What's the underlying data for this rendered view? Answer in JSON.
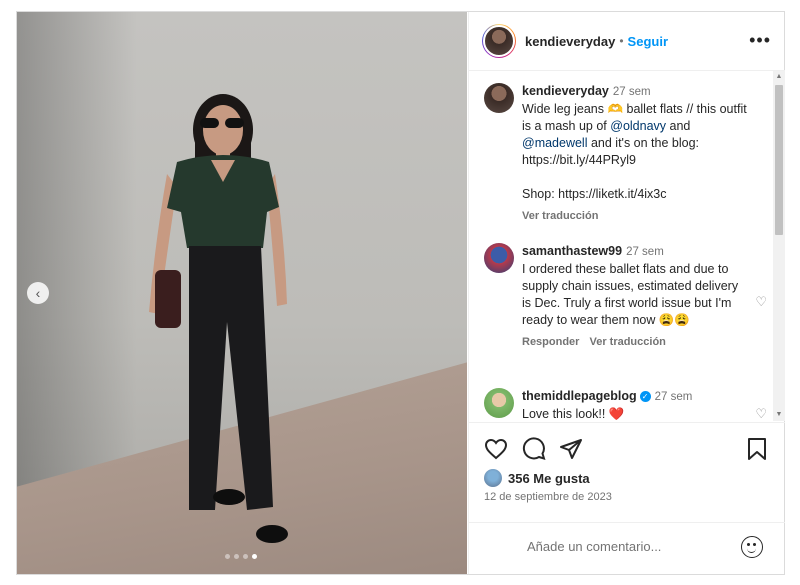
{
  "header": {
    "username": "kendieveryday",
    "separator": "•",
    "follow": "Seguir",
    "more": "•••"
  },
  "caption": {
    "username": "kendieveryday",
    "time": "27 sem",
    "text_1": "Wide leg jeans 🫶 ballet flats // this outfit is a mash up of ",
    "mention_1": "@oldnavy",
    "text_2": " and ",
    "mention_2": "@madewell",
    "text_3": " and it's on the blog: https://bit.ly/44PRyl9",
    "shop": "Shop: https://liketk.it/4ix3c",
    "translate": "Ver traducción"
  },
  "comments": [
    {
      "username": "samanthastew99",
      "time": "27 sem",
      "text": "I ordered these ballet flats and due to supply chain issues, estimated delivery is Dec. Truly a first world issue but I'm ready to wear them now 😩😩",
      "reply": "Responder",
      "translate": "Ver traducción"
    },
    {
      "username": "themiddlepageblog",
      "time": "27 sem",
      "text": "Love this look!! ❤️"
    }
  ],
  "likes": "356 Me gusta",
  "date": "12 de septiembre de 2023",
  "add_comment_placeholder": "Añade un comentario...",
  "icons": [
    "heart-icon",
    "comment-icon",
    "share-icon",
    "bookmark-icon",
    "emoji-icon",
    "chevron-left-icon",
    "more-icon"
  ],
  "colors": {
    "accent": "#0095f6",
    "mention": "#00376b"
  }
}
